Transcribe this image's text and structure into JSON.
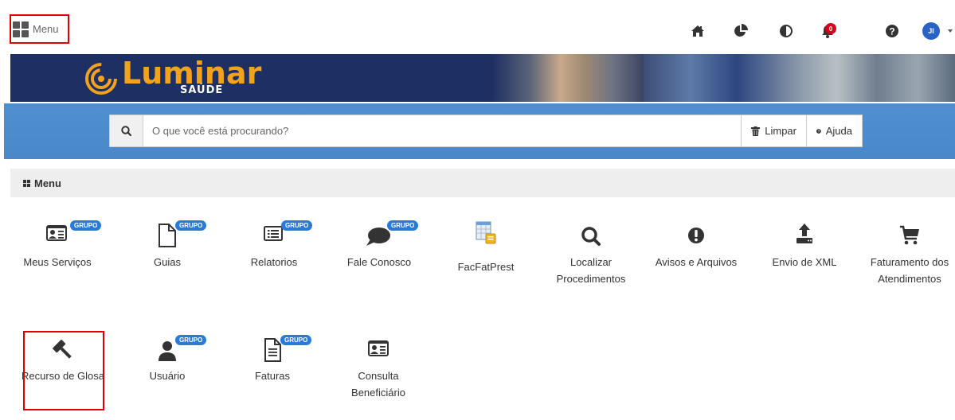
{
  "topbar": {
    "menu_label": "Menu",
    "icons": [
      "home-icon",
      "pie-chart-icon",
      "contrast-icon",
      "bell-icon",
      "help-icon"
    ],
    "notification_count": "0",
    "avatar_initials": "JI"
  },
  "banner": {
    "logo_text": "Luminar",
    "logo_sub": "SAÚDE",
    "colors": {
      "navy": "#1e2f63",
      "orange": "#f3a21b"
    }
  },
  "search": {
    "placeholder": "O que você está procurando?",
    "clear_label": "Limpar",
    "help_label": "Ajuda"
  },
  "section": {
    "title": "Menu"
  },
  "tiles": [
    {
      "label": "Meus Serviços",
      "badge": "GRUPO",
      "icon": "id-card-icon"
    },
    {
      "label": "Guias",
      "badge": "GRUPO",
      "icon": "document-icon"
    },
    {
      "label": "Relatorios",
      "badge": "GRUPO",
      "icon": "list-icon"
    },
    {
      "label": "Fale Conosco",
      "badge": "GRUPO",
      "icon": "chat-bubble-icon"
    },
    {
      "label": "FacFatPrest",
      "badge": "",
      "icon": "spreadsheet-icon"
    },
    {
      "label": "Localizar Procedimentos",
      "badge": "",
      "icon": "search-icon"
    },
    {
      "label": "Avisos e Arquivos",
      "badge": "",
      "icon": "alert-icon"
    },
    {
      "label": "Envio de XML",
      "badge": "",
      "icon": "upload-icon"
    },
    {
      "label": "Faturamento dos Atendimentos",
      "badge": "",
      "icon": "cart-icon"
    },
    {
      "label": "Recurso de Glosa",
      "badge": "",
      "icon": "gavel-icon"
    },
    {
      "label": "Usuário",
      "badge": "GRUPO",
      "icon": "user-icon"
    },
    {
      "label": "Faturas",
      "badge": "GRUPO",
      "icon": "invoice-icon"
    },
    {
      "label": "Consulta Beneficiário",
      "badge": "",
      "icon": "id-card-icon"
    }
  ],
  "accent_colors": {
    "highlight_red": "#e00000",
    "search_band_blue": "#4c8dd0",
    "badge_blue": "#2a7bd6"
  }
}
